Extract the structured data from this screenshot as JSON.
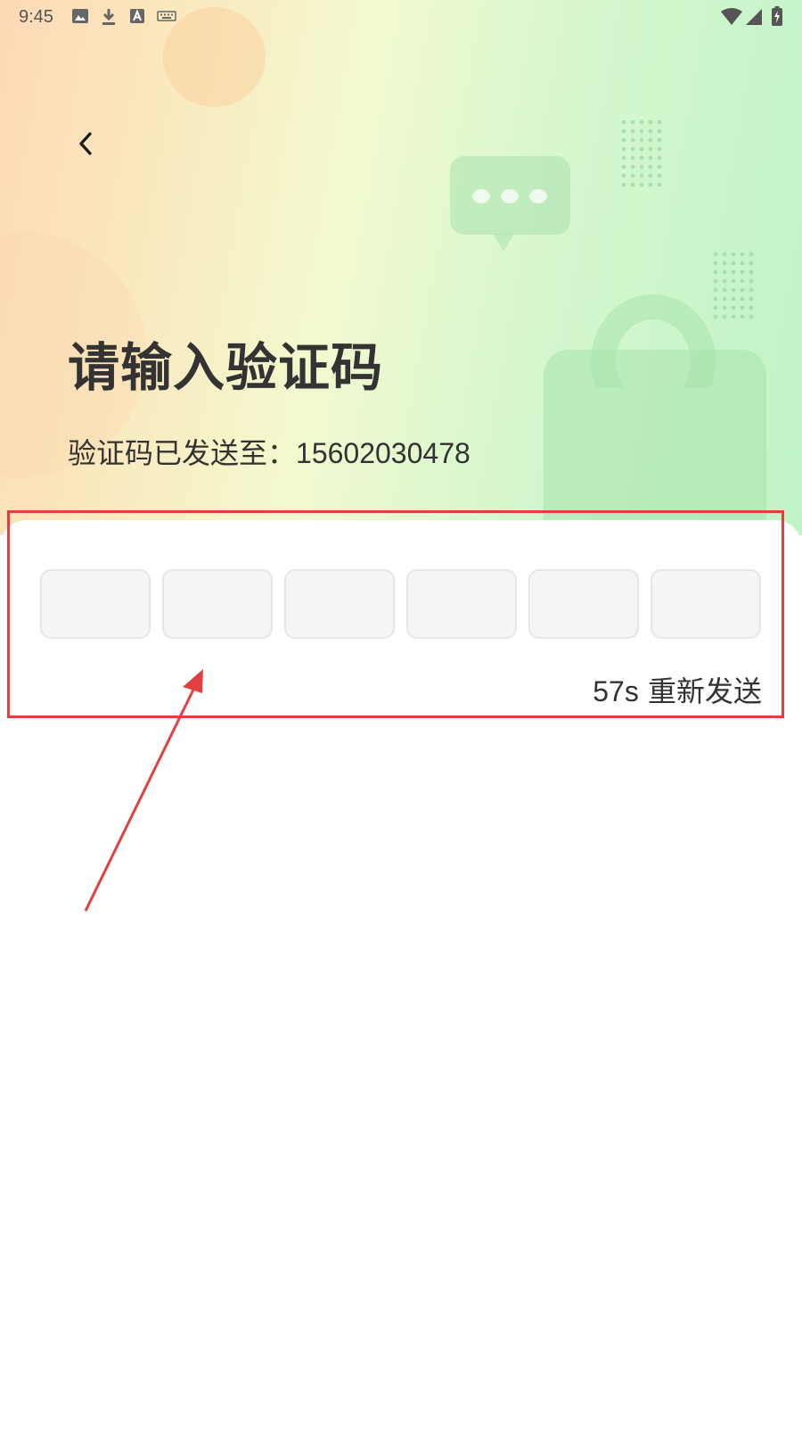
{
  "status_bar": {
    "time": "9:45",
    "left_icons": [
      "image-icon",
      "download-icon",
      "text-a-icon",
      "keyboard-icon"
    ],
    "right_icons": [
      "wifi-icon",
      "signal-icon",
      "battery-charging-icon"
    ]
  },
  "header": {
    "back_icon": "chevron-left-icon"
  },
  "hero": {
    "title": "请输入验证码",
    "sent_label": "验证码已发送至：",
    "phone": "15602030478"
  },
  "code_input": {
    "length": 6,
    "digits": [
      "",
      "",
      "",
      "",
      "",
      ""
    ]
  },
  "resend": {
    "countdown": "57s",
    "label": "重新发送"
  },
  "annotation": {
    "highlight_color": "#e24040",
    "arrow_color": "#e24040"
  },
  "colors": {
    "text_primary": "#333333",
    "box_fill": "#f5f5f5",
    "box_border": "#e6e6e6"
  }
}
